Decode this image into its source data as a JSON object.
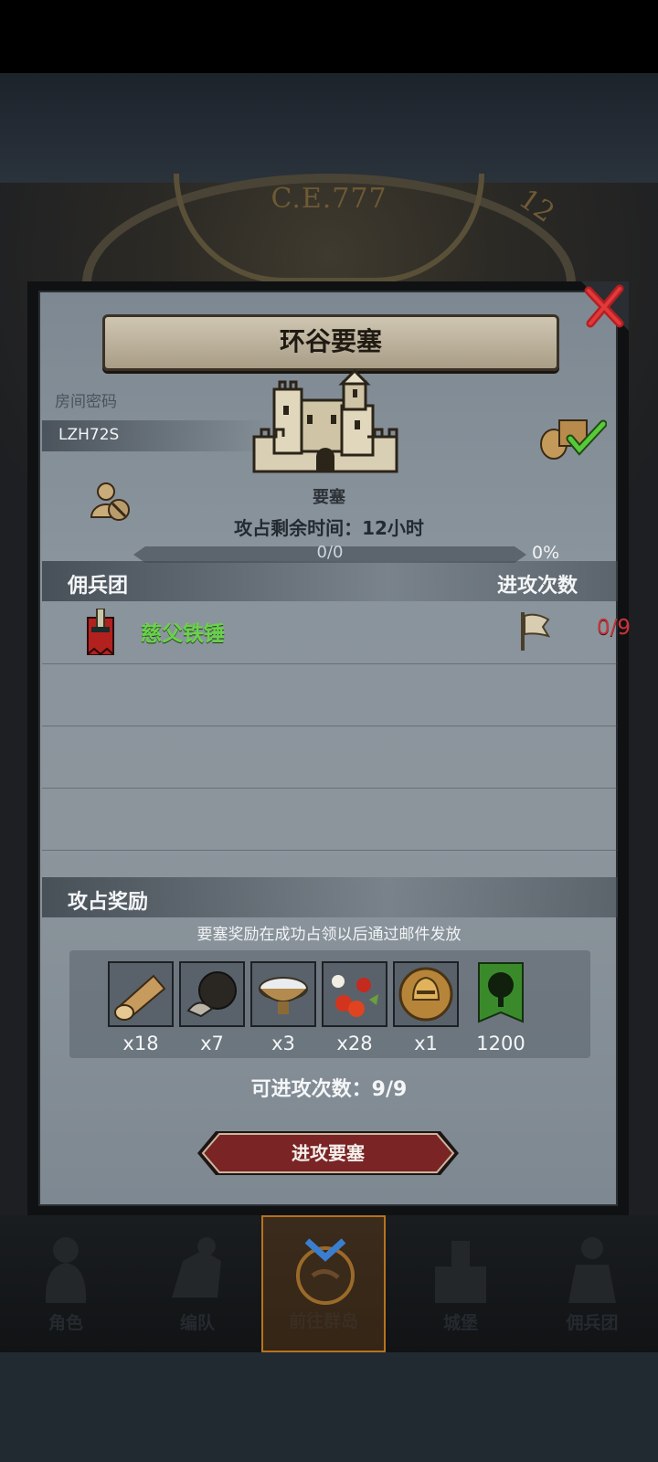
{
  "header": {
    "era": "C.E.777",
    "hour": "12"
  },
  "panel": {
    "title": "环谷要塞",
    "room_code_label": "房间密码",
    "room_code": "LZH72S",
    "building_label": "要塞",
    "time_remaining": "攻占剩余时间：12小时",
    "progress_text": "0/0",
    "progress_fraction": 0,
    "progress_percent": "0%"
  },
  "mercenary_section": {
    "title": "佣兵团",
    "attacks_header": "进攻次数",
    "rows": [
      {
        "name": "慈父铁锤",
        "attacks": "0/9"
      }
    ]
  },
  "rewards_section": {
    "title": "攻占奖励",
    "note": "要塞奖励在成功占领以后通过邮件发放",
    "items": [
      {
        "icon": "wood-log-icon",
        "qty": "x18"
      },
      {
        "icon": "truffle-icon",
        "qty": "x7"
      },
      {
        "icon": "bowl-icon",
        "qty": "x3"
      },
      {
        "icon": "berries-icon",
        "qty": "x28"
      },
      {
        "icon": "knight-helmet-icon",
        "qty": "x1"
      },
      {
        "icon": "tree-banner-icon",
        "qty": "1200"
      }
    ],
    "attempts": "可进攻次数：9/9",
    "attack_button": "进攻要塞"
  },
  "nav": {
    "items": [
      {
        "label": "角色"
      },
      {
        "label": "编队"
      },
      {
        "label": "前往群岛"
      },
      {
        "label": "城堡"
      },
      {
        "label": "佣兵团"
      }
    ]
  },
  "colors": {
    "accent_gold": "#d8a748",
    "name_green": "#69d24a",
    "count_red": "#c8343a",
    "button_red": "#7a2426"
  }
}
